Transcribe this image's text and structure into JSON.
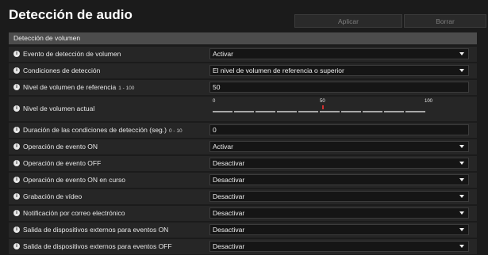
{
  "header": {
    "title": "Detección de audio",
    "apply_label": "Aplicar",
    "clear_label": "Borrar"
  },
  "section": {
    "title": "Detección de volumen"
  },
  "rows": [
    {
      "label": "Evento de detección de volumen",
      "range": "",
      "value": "Activar"
    },
    {
      "label": "Condiciones de detección",
      "range": "",
      "value": "El nivel de volumen de referencia o superior"
    },
    {
      "label": "Nivel de volumen de referencia",
      "range": "1 - 100",
      "value": "50"
    },
    {
      "label": "Nivel de volumen actual",
      "range": "",
      "meter": {
        "min_label": "0",
        "mid_label": "50",
        "max_label": "100",
        "current_level": 0,
        "reference_level": 50
      }
    },
    {
      "label": "Duración de las condiciones de detección (seg.)",
      "range": "0 - 10",
      "value": "0"
    },
    {
      "label": "Operación de evento ON",
      "range": "",
      "value": "Activar"
    },
    {
      "label": "Operación de evento OFF",
      "range": "",
      "value": "Desactivar"
    },
    {
      "label": "Operación de evento ON en curso",
      "range": "",
      "value": "Desactivar"
    },
    {
      "label": "Grabación de vídeo",
      "range": "",
      "value": "Desactivar"
    },
    {
      "label": "Notificación por correo electrónico",
      "range": "",
      "value": "Desactivar"
    },
    {
      "label": "Salida de dispositivos externos para eventos ON",
      "range": "",
      "value": "Desactivar"
    },
    {
      "label": "Salida de dispositivos externos para eventos OFF",
      "range": "",
      "value": "Desactivar"
    }
  ],
  "icons": {
    "info": "info-icon",
    "dropdown": "chevron-down-icon"
  },
  "colors": {
    "background": "#1b1b1b",
    "row": "#262626",
    "section": "#4c4c4c",
    "marker": "#d03030"
  }
}
